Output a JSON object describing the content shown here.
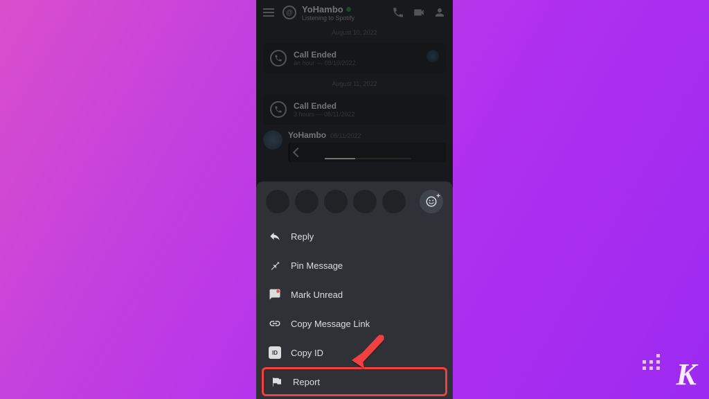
{
  "header": {
    "username": "YoHambo",
    "status_prefix": "Listening to ",
    "status_app": "Spotify"
  },
  "dividers": {
    "date1": "August 10, 2022",
    "date2": "August 11, 2022"
  },
  "calls": [
    {
      "title": "Call Ended",
      "subtitle": "an hour — 08/10/2022"
    },
    {
      "title": "Call Ended",
      "subtitle": "3 hours — 08/11/2022"
    }
  ],
  "message": {
    "author": "YoHambo",
    "timestamp": "08/11/2022"
  },
  "menu": {
    "reply": "Reply",
    "pin": "Pin Message",
    "mark_unread": "Mark Unread",
    "copy_link": "Copy Message Link",
    "copy_id": "Copy ID",
    "copy_id_badge": "ID",
    "report": "Report"
  },
  "watermark": "K"
}
